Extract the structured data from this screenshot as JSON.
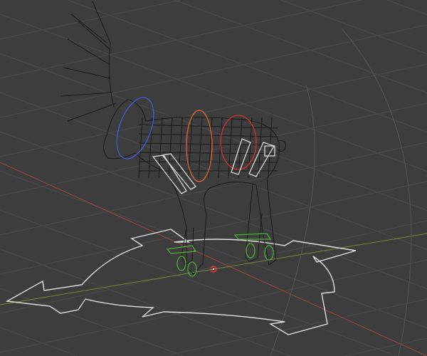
{
  "viewport": {
    "background": "#3d3d3d",
    "grid_color": "#4a4a4a",
    "x_axis_color": "#9a4848",
    "y_axis_color": "#6f8a3a",
    "wire_color": "#1a1a1a",
    "control_color": "#e0e0e0",
    "origin_icon": "3d-cursor-icon"
  },
  "rig": {
    "neck_control_color": "#4a5ad8",
    "spine_control_color": "#e0652e",
    "hip_control_color": "#d83030",
    "foot_control_color": "#4caf3a"
  }
}
